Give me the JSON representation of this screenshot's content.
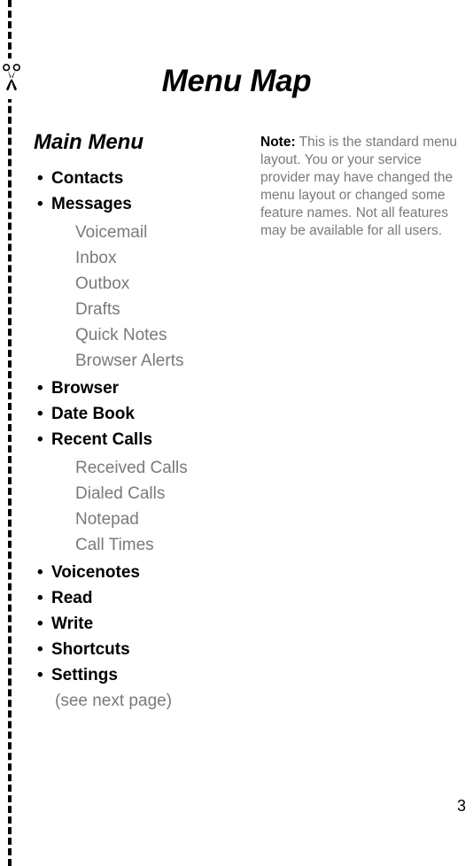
{
  "document": {
    "title": "Menu Map",
    "page_number": "3"
  },
  "cut_line": {
    "icon": "scissors-icon",
    "color": "#000000"
  },
  "left_column": {
    "section_title": "Main Menu",
    "bullet_glyph": "•",
    "entries": [
      {
        "label": "Contacts",
        "sub_items": []
      },
      {
        "label": "Messages",
        "sub_items": [
          "Voicemail",
          "Inbox",
          "Outbox",
          "Drafts",
          "Quick Notes",
          "Browser Alerts"
        ]
      },
      {
        "label": "Browser",
        "sub_items": []
      },
      {
        "label": "Date Book",
        "sub_items": []
      },
      {
        "label": "Recent Calls",
        "sub_items": [
          "Received Calls",
          "Dialed Calls",
          "Notepad",
          "Call Times"
        ]
      },
      {
        "label": "Voicenotes",
        "sub_items": []
      },
      {
        "label": "Read",
        "sub_items": []
      },
      {
        "label": "Write",
        "sub_items": []
      },
      {
        "label": "Shortcuts",
        "sub_items": []
      },
      {
        "label": "Settings",
        "sub_items": [],
        "footnote": "(see next page)"
      }
    ]
  },
  "note": {
    "label": "Note:",
    "text": " This is the standard menu layout. You or your service provider may have changed the menu layout or changed some feature names. Not all features may be available for all users."
  }
}
